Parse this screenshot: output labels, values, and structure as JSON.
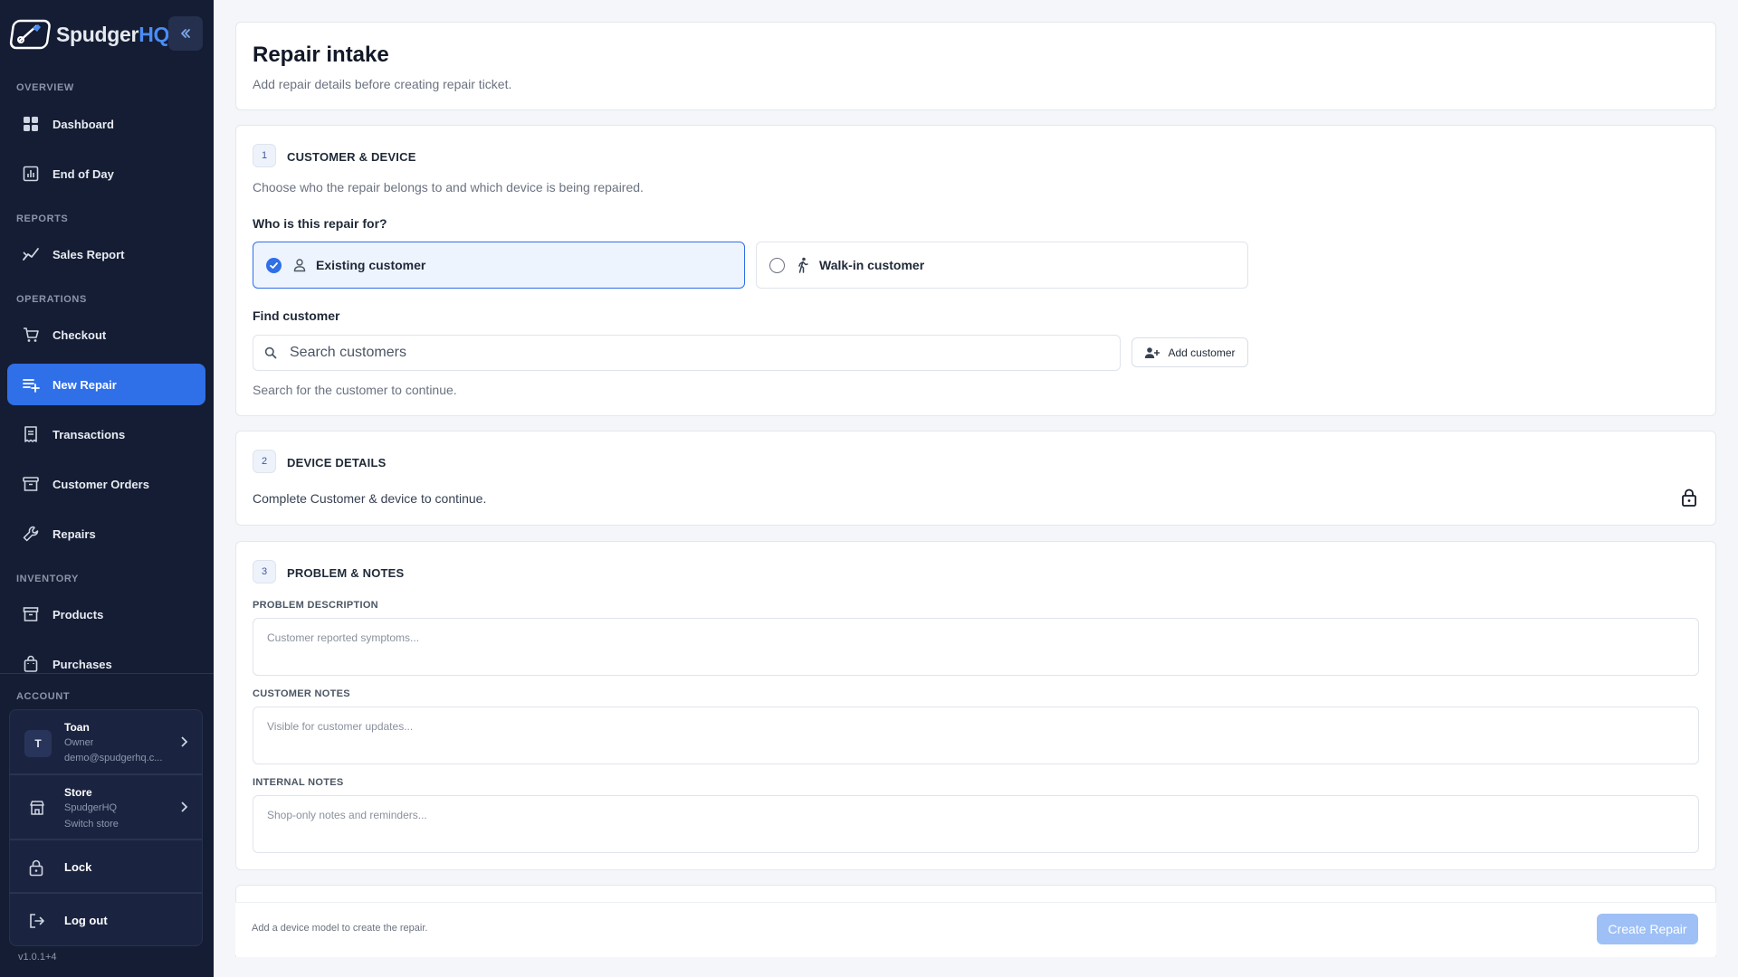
{
  "brand": {
    "name_primary": "Spudger",
    "name_accent": "HQ"
  },
  "sidebar": {
    "sections": {
      "overview": "OVERVIEW",
      "reports": "REPORTS",
      "operations": "OPERATIONS",
      "inventory": "INVENTORY",
      "account": "ACCOUNT"
    },
    "items": {
      "dashboard": "Dashboard",
      "end_of_day": "End of Day",
      "sales_report": "Sales Report",
      "checkout": "Checkout",
      "new_repair": "New Repair",
      "transactions": "Transactions",
      "customer_orders": "Customer Orders",
      "repairs": "Repairs",
      "products": "Products",
      "purchases": "Purchases"
    },
    "active_item": "new_repair",
    "account": {
      "user_initial": "T",
      "user_name": "Toan",
      "user_role": "Owner",
      "user_email": "demo@spudgerhq.c...",
      "store_title": "Store",
      "store_name": "SpudgerHQ",
      "store_action": "Switch store",
      "lock": "Lock",
      "logout": "Log out"
    },
    "version": "v1.0.1+4"
  },
  "header": {
    "title": "Repair intake",
    "subtitle": "Add repair details before creating repair ticket."
  },
  "step1": {
    "number": "1",
    "title": "CUSTOMER & DEVICE",
    "description": "Choose who the repair belongs to and which device is being repaired.",
    "question": "Who is this repair for?",
    "option_existing": "Existing customer",
    "option_walkin": "Walk-in customer",
    "selected_option": "existing",
    "find_label": "Find customer",
    "search_placeholder": "Search customers",
    "add_customer": "Add customer",
    "hint": "Search for the customer to continue."
  },
  "step2": {
    "number": "2",
    "title": "DEVICE DETAILS",
    "locked_message": "Complete Customer & device to continue."
  },
  "step3": {
    "number": "3",
    "title": "PROBLEM & NOTES",
    "problem_label": "PROBLEM DESCRIPTION",
    "problem_placeholder": "Customer reported symptoms...",
    "customer_notes_label": "CUSTOMER NOTES",
    "customer_notes_placeholder": "Visible for customer updates...",
    "internal_notes_label": "INTERNAL NOTES",
    "internal_notes_placeholder": "Shop-only notes and reminders..."
  },
  "footer": {
    "note": "Add a device model to create the repair.",
    "create_button": "Create Repair"
  },
  "colors": {
    "sidebar_bg": "#141d33",
    "accent": "#2f6fe8",
    "brand_accent": "#4a8cf7",
    "create_disabled": "#9ec0f6"
  },
  "icons": {
    "dashboard": "grid-icon",
    "end_of_day": "chart-icon",
    "sales_report": "trend-icon",
    "checkout": "cart-icon",
    "new_repair": "playlist-add-icon",
    "transactions": "receipt-icon",
    "customer_orders": "archive-icon",
    "repairs": "wrench-icon",
    "products": "box-icon",
    "purchases": "bag-icon"
  }
}
